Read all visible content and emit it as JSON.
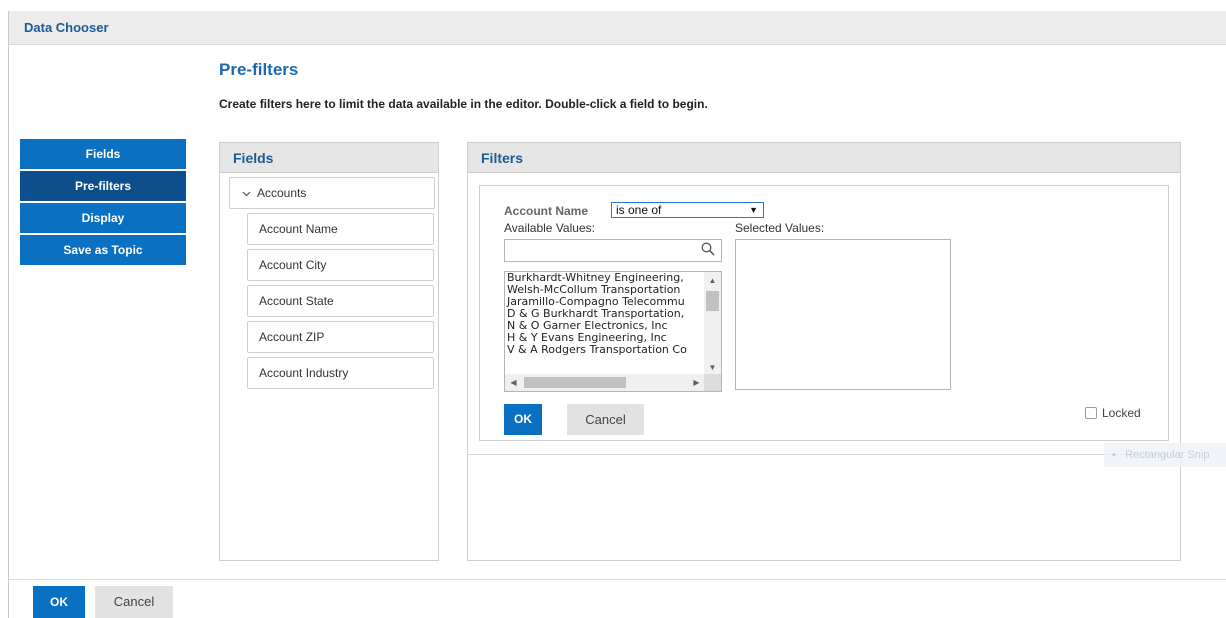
{
  "window": {
    "title": "Data Chooser"
  },
  "page": {
    "title": "Pre-filters",
    "description": "Create filters here to limit the data available in the editor. Double-click a field to begin."
  },
  "nav": {
    "items": [
      {
        "label": "Fields",
        "active": false
      },
      {
        "label": "Pre-filters",
        "active": true
      },
      {
        "label": "Display",
        "active": false
      },
      {
        "label": "Save as Topic",
        "active": false
      }
    ]
  },
  "fields_panel": {
    "title": "Fields",
    "group": {
      "label": "Accounts",
      "icon": "chevron-down-icon",
      "expanded": true
    },
    "fields": [
      "Account Name",
      "Account City",
      "Account State",
      "Account ZIP",
      "Account Industry"
    ]
  },
  "filters_panel": {
    "title": "Filters",
    "field_name": "Account Name",
    "operator": "is one of",
    "available_label": "Available Values:",
    "selected_label": "Selected Values:",
    "search_value": "",
    "search_icon": "search-icon",
    "available_values": [
      "Burkhardt-Whitney Engineering,",
      "Welsh-McCollum Transportation",
      "Jaramillo-Compagno Telecommu",
      "D & G Burkhardt Transportation,",
      "N & O Garner Electronics, Inc",
      "H & Y Evans Engineering, Inc",
      "V & A Rodgers Transportation Co"
    ],
    "ok_label": "OK",
    "cancel_label": "Cancel",
    "locked_label": "Locked",
    "locked_checked": false
  },
  "overlay": {
    "ghost_text": "Rectangular Snip"
  },
  "footer": {
    "ok_label": "OK",
    "cancel_label": "Cancel"
  },
  "colors": {
    "accent": "#0a70c2",
    "nav_active": "#0d4f8c",
    "title_blue": "#1e6ab0"
  }
}
